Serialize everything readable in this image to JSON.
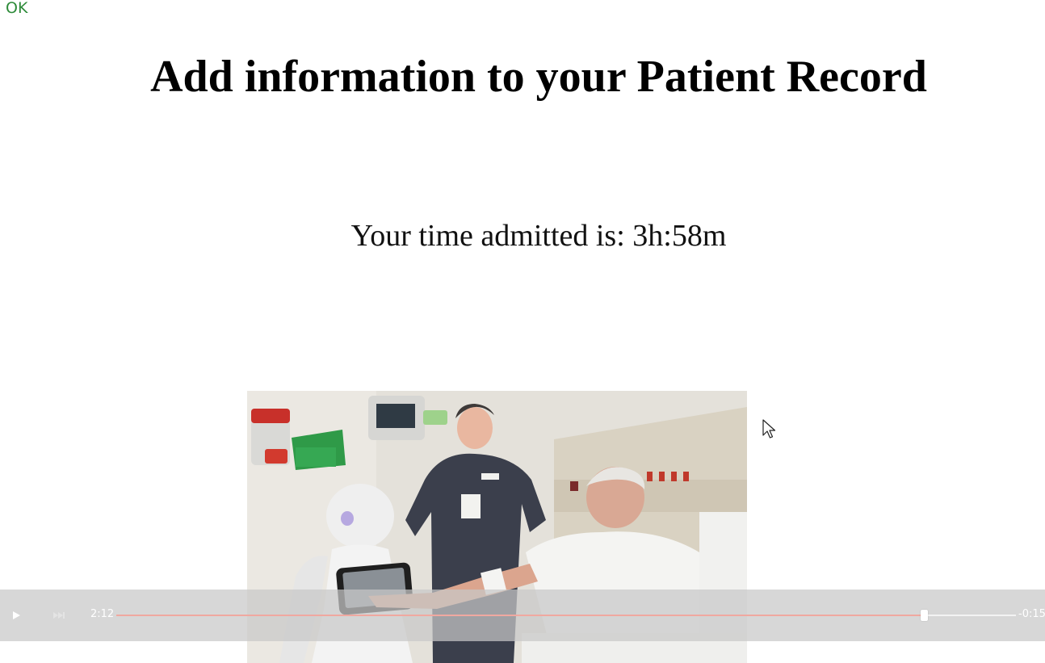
{
  "ok_link": "OK",
  "page_title": "Add information to your Patient Record",
  "admitted": {
    "label": "Your time admitted is:",
    "value": "3h:58m"
  },
  "video": {
    "description_icon": "video-frame",
    "controls": {
      "play_icon": "play-icon",
      "next_icon": "skip-next-icon",
      "elapsed": "2:12",
      "remaining": "-0:15",
      "progress_fraction": 0.898
    }
  },
  "colors": {
    "ok_link": "#2e8b3a",
    "seek_played": "#f0a8a0",
    "control_bar": "#c8c8c8"
  }
}
